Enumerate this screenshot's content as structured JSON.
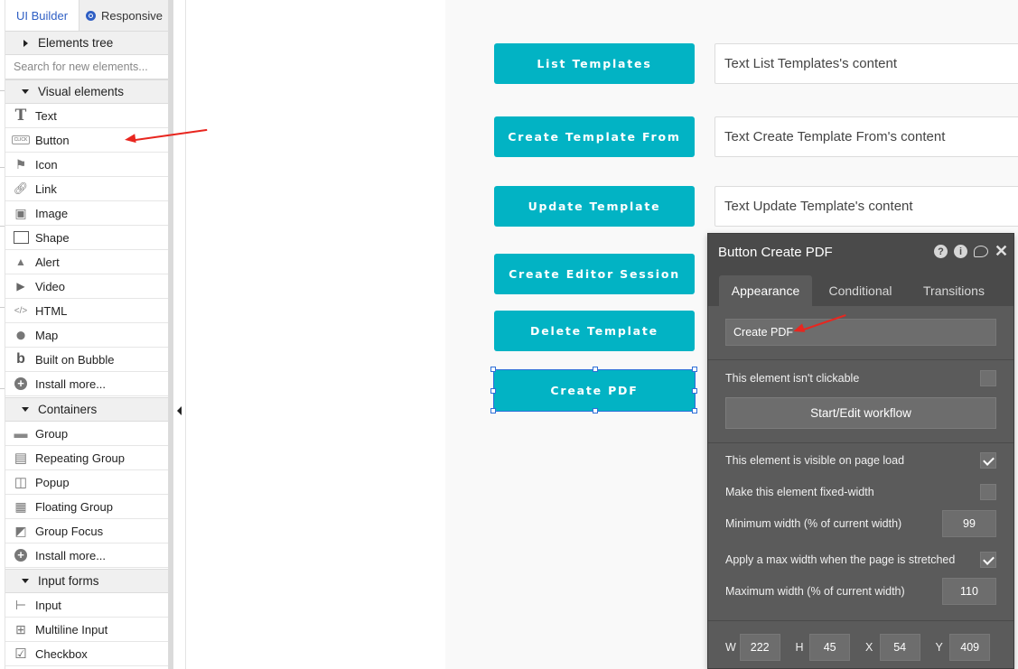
{
  "left_panel": {
    "tabs": {
      "ui_builder": "UI Builder",
      "responsive": "Responsive"
    },
    "elements_tree": "Elements tree",
    "search_placeholder": "Search for new elements...",
    "sections": {
      "visual": {
        "label": "Visual elements",
        "items": [
          {
            "label": "Text",
            "icon": "text-icon"
          },
          {
            "label": "Button",
            "icon": "button-icon"
          },
          {
            "label": "Icon",
            "icon": "flag-icon"
          },
          {
            "label": "Link",
            "icon": "link-icon"
          },
          {
            "label": "Image",
            "icon": "image-icon"
          },
          {
            "label": "Shape",
            "icon": "shape-icon"
          },
          {
            "label": "Alert",
            "icon": "bell-icon"
          },
          {
            "label": "Video",
            "icon": "video-icon"
          },
          {
            "label": "HTML",
            "icon": "code-icon"
          },
          {
            "label": "Map",
            "icon": "map-pin-icon"
          },
          {
            "label": "Built on Bubble",
            "icon": "bubble-logo-icon"
          },
          {
            "label": "Install more...",
            "icon": "plus-circle-icon"
          }
        ]
      },
      "containers": {
        "label": "Containers",
        "items": [
          {
            "label": "Group",
            "icon": "folder-icon"
          },
          {
            "label": "Repeating Group",
            "icon": "repeating-group-icon"
          },
          {
            "label": "Popup",
            "icon": "popup-icon"
          },
          {
            "label": "Floating Group",
            "icon": "floating-group-icon"
          },
          {
            "label": "Group Focus",
            "icon": "group-focus-icon"
          },
          {
            "label": "Install more...",
            "icon": "plus-circle-icon"
          }
        ]
      },
      "input_forms": {
        "label": "Input forms",
        "items": [
          {
            "label": "Input",
            "icon": "input-icon"
          },
          {
            "label": "Multiline Input",
            "icon": "multiline-input-icon"
          },
          {
            "label": "Checkbox",
            "icon": "checkbox-icon"
          }
        ]
      }
    }
  },
  "canvas": {
    "rows": [
      {
        "button": "List Templates",
        "text": "Text List Templates's content"
      },
      {
        "button": "Create Template From",
        "text": "Text Create Template From's content"
      },
      {
        "button": "Update Template",
        "text": "Text Update Template's content"
      },
      {
        "button": "Create Editor Session",
        "text": ""
      },
      {
        "button": "Delete Template",
        "text": ""
      },
      {
        "button": "Create PDF",
        "text": ""
      }
    ],
    "button_color": "#02b3c4",
    "selection_color": "#2f6fd8"
  },
  "property_editor": {
    "title": "Button Create PDF",
    "tabs": [
      "Appearance",
      "Conditional",
      "Transitions"
    ],
    "active_tab": "Appearance",
    "button_text": "Create PDF",
    "not_clickable_label": "This element isn't clickable",
    "not_clickable_checked": false,
    "workflow_button": "Start/Edit workflow",
    "visible_on_load_label": "This element is visible on page load",
    "visible_on_load_checked": true,
    "fixed_width_label": "Make this element fixed-width",
    "fixed_width_checked": false,
    "min_width_label": "Minimum width (% of current width)",
    "min_width_value": "99",
    "apply_max_label": "Apply a max width when the page is stretched",
    "apply_max_checked": true,
    "max_width_label": "Maximum width (% of current width)",
    "max_width_value": "110",
    "dims": {
      "w_label": "W",
      "w": "222",
      "h_label": "H",
      "h": "45",
      "x_label": "X",
      "x": "54",
      "y_label": "Y",
      "y": "409"
    },
    "header_icons": [
      "help-icon",
      "info-icon",
      "comment-icon",
      "close-icon"
    ]
  },
  "annotations": {
    "arrow_color": "#e8261f"
  }
}
